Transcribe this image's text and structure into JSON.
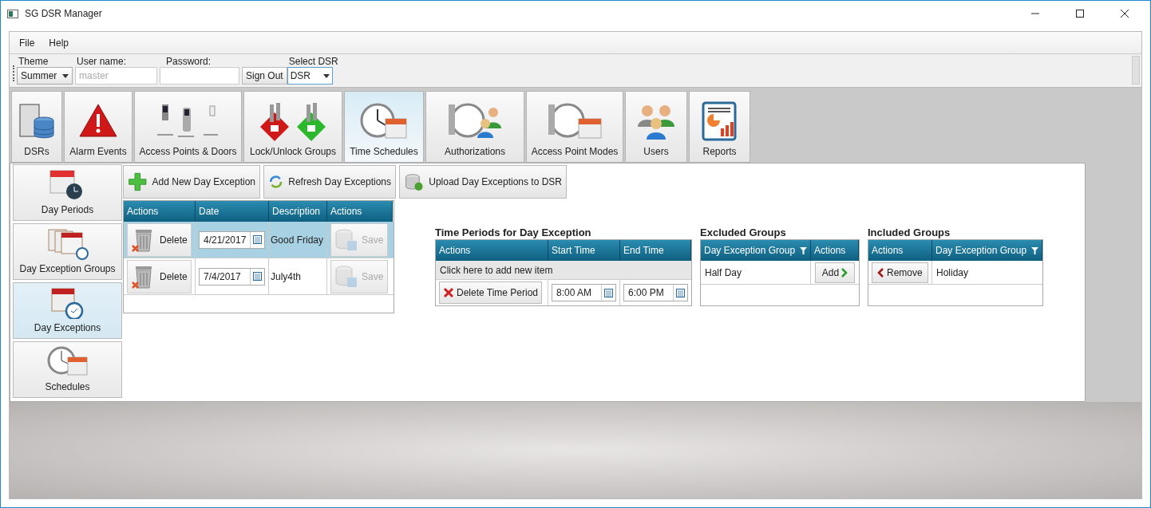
{
  "window": {
    "title": "SG DSR Manager"
  },
  "menu": [
    "File",
    "Help"
  ],
  "toolbar": {
    "theme": {
      "label": "Theme",
      "value": "Summer"
    },
    "username": {
      "label": "User name:",
      "placeholder": "master"
    },
    "password": {
      "label": "Password:"
    },
    "sign_out": "Sign Out",
    "select_dsr": {
      "label": "Select DSR",
      "value": "DSR"
    }
  },
  "main_tabs": [
    {
      "label": "DSRs",
      "selected": false
    },
    {
      "label": "Alarm Events",
      "selected": false
    },
    {
      "label": "Access Points & Doors",
      "selected": false
    },
    {
      "label": "Lock/Unlock Groups",
      "selected": false
    },
    {
      "label": "Time Schedules",
      "selected": true
    },
    {
      "label": "Authorizations",
      "selected": false
    },
    {
      "label": "Access Point Modes",
      "selected": false
    },
    {
      "label": "Users",
      "selected": false
    },
    {
      "label": "Reports",
      "selected": false
    }
  ],
  "side_tabs": [
    {
      "label": "Day Periods",
      "selected": false
    },
    {
      "label": "Day Exception Groups",
      "selected": false
    },
    {
      "label": "Day Exceptions",
      "selected": true
    },
    {
      "label": "Schedules",
      "selected": false
    }
  ],
  "actions": [
    "Add New Day Exception",
    "Refresh Day Exceptions",
    "Upload Day Exceptions to DSR"
  ],
  "day_exceptions": {
    "columns": [
      "Actions",
      "Date",
      "Description",
      "Actions"
    ],
    "rows": [
      {
        "delete": "Delete",
        "date": "4/21/2017",
        "description": "Good Friday",
        "save": "Save",
        "save_disabled": true,
        "selected": true
      },
      {
        "delete": "Delete",
        "date": "7/4/2017",
        "description": "July4th",
        "save": "Save",
        "save_disabled": true,
        "selected": false
      }
    ]
  },
  "time_periods": {
    "title": "Time Periods for Day Exception",
    "columns": [
      "Actions",
      "Start Time",
      "End Time"
    ],
    "add_row": "Click here to add new item",
    "rows": [
      {
        "delete": "Delete Time Period",
        "start": "8:00 AM",
        "end": "6:00 PM"
      }
    ]
  },
  "excluded_groups": {
    "title": "Excluded Groups",
    "columns": [
      "Day Exception Group",
      "Actions"
    ],
    "rows": [
      {
        "group": "Half Day",
        "action": "Add"
      }
    ]
  },
  "included_groups": {
    "title": "Included Groups",
    "columns": [
      "Actions",
      "Day Exception Group"
    ],
    "rows": [
      {
        "action": "Remove",
        "group": "Holiday"
      }
    ]
  }
}
